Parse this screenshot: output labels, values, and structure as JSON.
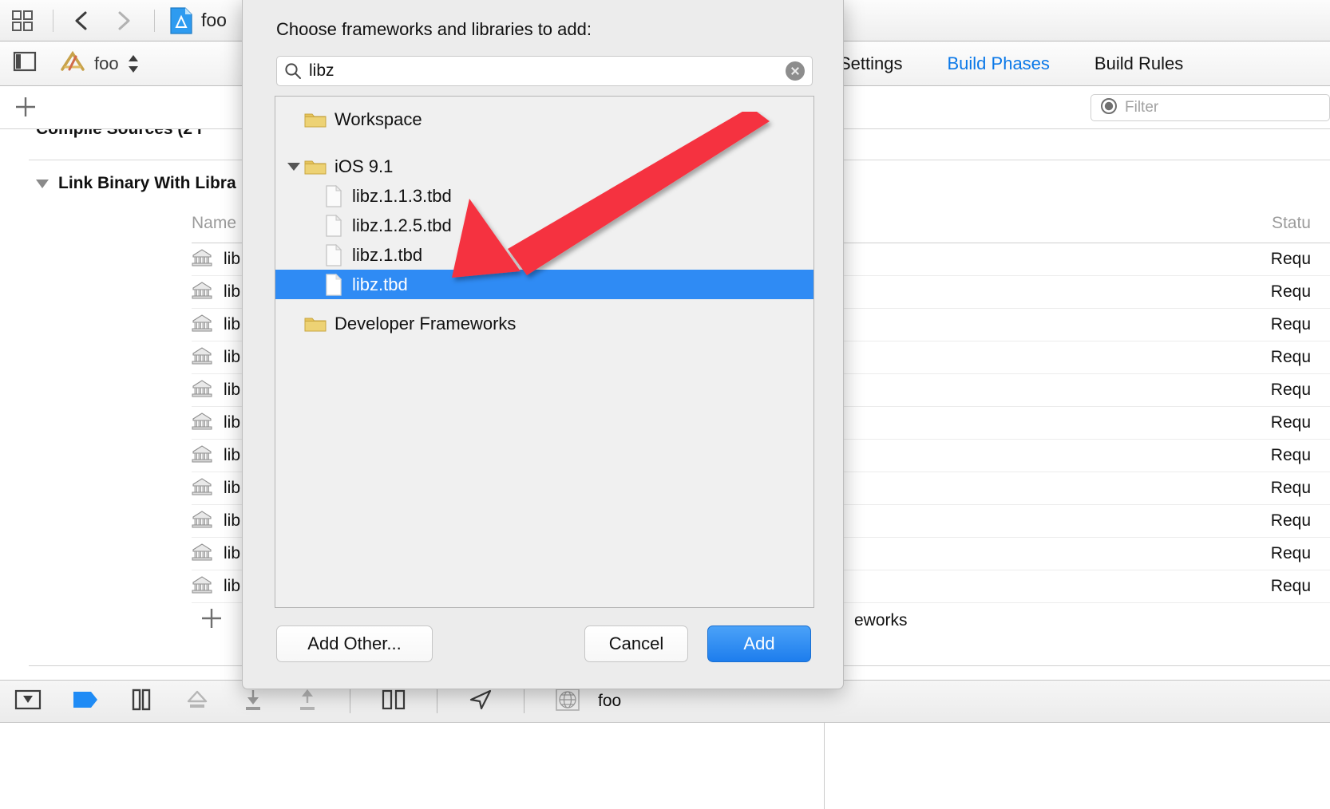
{
  "window": {
    "titlebar": {
      "navigator_toggle_icon": "grid-icon",
      "back_icon": "chevron-left-icon",
      "forward_icon": "chevron-right-icon",
      "project_icon": "xcode-project-file-icon",
      "project_name": "foo"
    },
    "jumpbar": {
      "sidebar_toggle_icon": "left-panel-icon",
      "scheme_icon": "xcode-app-target-icon",
      "scheme_name": "foo",
      "stepper_icon": "stepper-up-down-icon"
    },
    "tabs": [
      {
        "label": "Settings",
        "active": false
      },
      {
        "label": "Build Phases",
        "active": true
      },
      {
        "label": "Build Rules",
        "active": false
      }
    ],
    "toolbar": {
      "add_phase_icon": "plus-icon",
      "filter_icon": "filter-circle-icon",
      "filter_placeholder": "Filter"
    }
  },
  "editor": {
    "ghost_phase_title": "Compile Sources (2 i",
    "phase_title": "Link Binary With Libra",
    "columns": {
      "name": "Name",
      "status": "Statu"
    },
    "rows": [
      {
        "name": "lib",
        "status": "Requ",
        "icon": "library-icon"
      },
      {
        "name": "lib",
        "status": "Requ",
        "icon": "library-icon"
      },
      {
        "name": "lib",
        "status": "Requ",
        "icon": "library-icon"
      },
      {
        "name": "lib",
        "status": "Requ",
        "icon": "library-icon"
      },
      {
        "name": "lib",
        "status": "Requ",
        "icon": "library-icon"
      },
      {
        "name": "lib",
        "status": "Requ",
        "icon": "library-icon"
      },
      {
        "name": "lib",
        "status": "Requ",
        "icon": "library-icon"
      },
      {
        "name": "lib",
        "status": "Requ",
        "icon": "library-icon"
      },
      {
        "name": "lib",
        "status": "Requ",
        "icon": "library-icon"
      },
      {
        "name": "lib",
        "status": "Requ",
        "icon": "library-icon"
      },
      {
        "name": "lib",
        "status": "Requ",
        "icon": "library-icon"
      }
    ],
    "add_row_icon": "plus-icon",
    "trailing_note": "eworks"
  },
  "bottom_toolbar": {
    "items": [
      {
        "icon": "hide-debug-area-icon",
        "name": "toggle-debug-area"
      },
      {
        "icon": "breakpoints-icon",
        "name": "breakpoints-toggle"
      },
      {
        "icon": "pause-icon",
        "name": "pause-button"
      },
      {
        "icon": "step-over-icon",
        "name": "step-over-button"
      },
      {
        "icon": "step-into-icon",
        "name": "step-into-button"
      },
      {
        "icon": "step-out-icon",
        "name": "step-out-button"
      },
      {
        "icon": "view-debug-hierarchy-icon",
        "name": "debug-view-hierarchy-button"
      },
      {
        "icon": "location-simulate-icon",
        "name": "simulate-location-button"
      },
      {
        "icon": "memory-graph-icon",
        "name": "memory-graph-button"
      }
    ],
    "process_label": "foo"
  },
  "sheet": {
    "title": "Choose frameworks and libraries to add:",
    "search": {
      "icon": "search-icon",
      "value": "libz",
      "clear_icon": "clear-circle-icon"
    },
    "tree": [
      {
        "label": "Workspace",
        "kind": "folder",
        "indent": 1,
        "expanded": null,
        "selected": false
      },
      {
        "label": "iOS 9.1",
        "kind": "folder",
        "indent": 0,
        "expanded": true,
        "selected": false
      },
      {
        "label": "libz.1.1.3.tbd",
        "kind": "file",
        "indent": 2,
        "expanded": null,
        "selected": false
      },
      {
        "label": "libz.1.2.5.tbd",
        "kind": "file",
        "indent": 2,
        "expanded": null,
        "selected": false
      },
      {
        "label": "libz.1.tbd",
        "kind": "file",
        "indent": 2,
        "expanded": null,
        "selected": false
      },
      {
        "label": "libz.tbd",
        "kind": "file",
        "indent": 2,
        "expanded": null,
        "selected": true
      },
      {
        "label": "Developer Frameworks",
        "kind": "folder",
        "indent": 1,
        "expanded": null,
        "selected": false
      }
    ],
    "buttons": {
      "add_other": "Add Other...",
      "cancel": "Cancel",
      "add": "Add"
    }
  },
  "annotation": {
    "arrow_icon": "red-arrow-annotation",
    "color": "#f5333f"
  },
  "colors": {
    "selection_blue": "#2f8bf4",
    "tab_active_blue": "#0a78e8",
    "primary_button_blue": "#1d7ded",
    "annotation_red": "#f5333f",
    "folder_yellow": "#e8c55c",
    "window_chrome": "#ececec"
  }
}
